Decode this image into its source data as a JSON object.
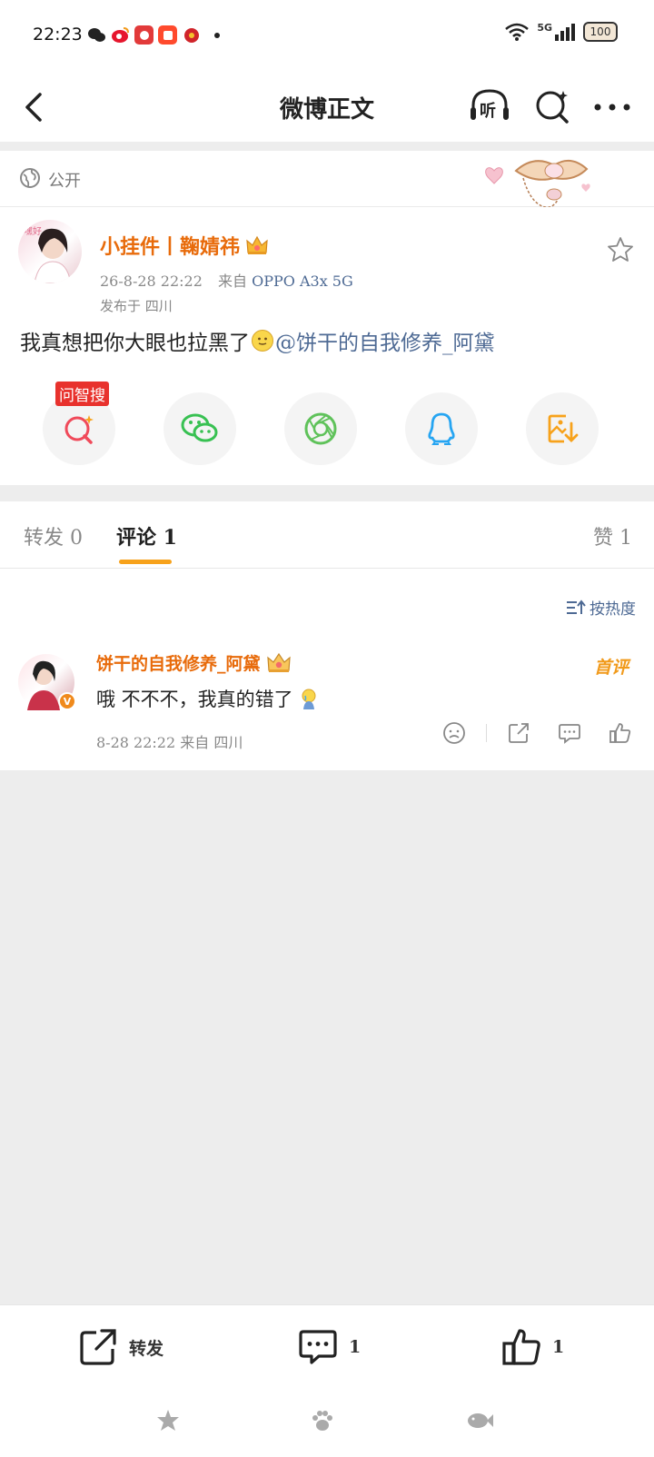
{
  "status_bar": {
    "time": "22:23",
    "network": "5G",
    "battery": "100"
  },
  "nav": {
    "title": "微博正文",
    "listen_label": "听"
  },
  "post": {
    "visibility": "公开",
    "username": "小挂件丨鞠婧祎",
    "timestamp": "26-8-28 22:22",
    "source_prefix": "来自",
    "source_device": "OPPO A3x 5G",
    "location": "发布于 四川",
    "content_text": "我真想把你大眼也拉黑了",
    "content_mention": "@饼干的自我修养_阿黛",
    "share_tag": "问智搜"
  },
  "tabs": {
    "repost": "转发 0",
    "comment": "评论 1",
    "like": "赞 1"
  },
  "comments": {
    "sort_label": "按热度",
    "items": [
      {
        "name": "饼干的自我修养_阿黛",
        "badge": "首评",
        "text": "哦 不不不，我真的错了",
        "meta": "8-28 22:22 来自 四川"
      }
    ]
  },
  "bottom_bar": {
    "repost_label": "转发",
    "comment_count": "1",
    "like_count": "1"
  },
  "colors": {
    "accent_orange": "#e86b0b",
    "link_blue": "#4e6a94",
    "tab_underline": "#f7a21b"
  }
}
